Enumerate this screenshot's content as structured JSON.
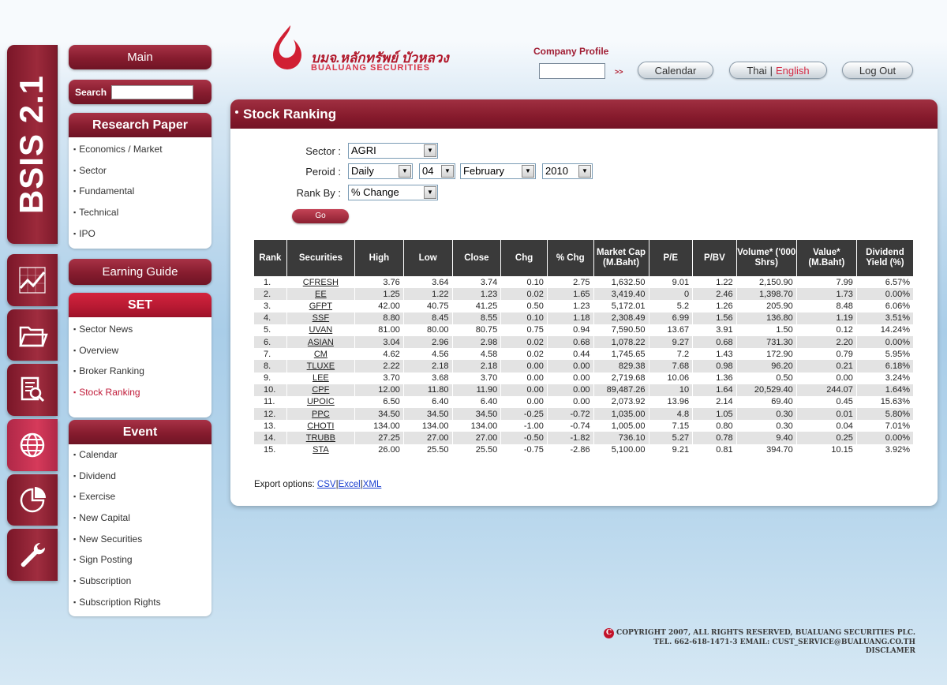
{
  "brand": {
    "thai_name": "บมจ.หลักทรัพย์ บัวหลวง",
    "english_name": "BUALUANG SECURITIES",
    "bsis_label": "BSIS 2.1"
  },
  "topbar": {
    "company_profile_label": "Company Profile",
    "company_profile_value": "",
    "go_arrow": ">>",
    "calendar_label": "Calendar",
    "lang_thai": "Thai",
    "lang_sep": "|",
    "lang_english": "English",
    "logout_label": "Log Out"
  },
  "sidebar": {
    "main_label": "Main",
    "search_label": "Search",
    "search_value": "",
    "research_title": "Research Paper",
    "research_items": [
      "Economics / Market",
      "Sector",
      "Fundamental",
      "Technical",
      "IPO"
    ],
    "earning_guide_label": "Earning Guide",
    "set_title": "SET",
    "set_items": [
      "Sector News",
      "Overview",
      "Broker Ranking",
      "Stock Ranking"
    ],
    "event_title": "Event",
    "event_items": [
      "Calendar",
      "Dividend",
      "Exercise",
      "New Capital",
      "New Securities",
      "Sign Posting",
      "Subscription",
      "Subscription Rights"
    ]
  },
  "icons": [
    "chart-icon",
    "folder-icon",
    "document-search-icon",
    "globe-icon",
    "pie-chart-icon",
    "wrench-icon"
  ],
  "page": {
    "title": "Stock Ranking"
  },
  "form": {
    "sector_label": "Sector :",
    "sector_value": "AGRI",
    "period_label": "Peroid :",
    "period_value": "Daily",
    "day_value": "04",
    "month_value": "February",
    "year_value": "2010",
    "rankby_label": "Rank By :",
    "rankby_value": "% Change",
    "go_label": "Go"
  },
  "table": {
    "headers": [
      "Rank",
      "Securities",
      "High",
      "Low",
      "Close",
      "Chg",
      "% Chg",
      "Market Cap (M.Baht)",
      "P/E",
      "P/BV",
      "Volume* ('000 Shrs)",
      "Value* (M.Baht)",
      "Dividend Yield (%)"
    ],
    "rows": [
      [
        "1.",
        "CFRESH",
        "3.76",
        "3.64",
        "3.74",
        "0.10",
        "2.75",
        "1,632.50",
        "9.01",
        "1.22",
        "2,150.90",
        "7.99",
        "6.57%"
      ],
      [
        "2.",
        "EE",
        "1.25",
        "1.22",
        "1.23",
        "0.02",
        "1.65",
        "3,419.40",
        "0",
        "2.46",
        "1,398.70",
        "1.73",
        "0.00%"
      ],
      [
        "3.",
        "GFPT",
        "42.00",
        "40.75",
        "41.25",
        "0.50",
        "1.23",
        "5,172.01",
        "5.2",
        "1.26",
        "205.90",
        "8.48",
        "6.06%"
      ],
      [
        "4.",
        "SSF",
        "8.80",
        "8.45",
        "8.55",
        "0.10",
        "1.18",
        "2,308.49",
        "6.99",
        "1.56",
        "136.80",
        "1.19",
        "3.51%"
      ],
      [
        "5.",
        "UVAN",
        "81.00",
        "80.00",
        "80.75",
        "0.75",
        "0.94",
        "7,590.50",
        "13.67",
        "3.91",
        "1.50",
        "0.12",
        "14.24%"
      ],
      [
        "6.",
        "ASIAN",
        "3.04",
        "2.96",
        "2.98",
        "0.02",
        "0.68",
        "1,078.22",
        "9.27",
        "0.68",
        "731.30",
        "2.20",
        "0.00%"
      ],
      [
        "7.",
        "CM",
        "4.62",
        "4.56",
        "4.58",
        "0.02",
        "0.44",
        "1,745.65",
        "7.2",
        "1.43",
        "172.90",
        "0.79",
        "5.95%"
      ],
      [
        "8.",
        "TLUXE",
        "2.22",
        "2.18",
        "2.18",
        "0.00",
        "0.00",
        "829.38",
        "7.68",
        "0.98",
        "96.20",
        "0.21",
        "6.18%"
      ],
      [
        "9.",
        "LEE",
        "3.70",
        "3.68",
        "3.70",
        "0.00",
        "0.00",
        "2,719.68",
        "10.06",
        "1.36",
        "0.50",
        "0.00",
        "3.24%"
      ],
      [
        "10.",
        "CPF",
        "12.00",
        "11.80",
        "11.90",
        "0.00",
        "0.00",
        "89,487.26",
        "10",
        "1.64",
        "20,529.40",
        "244.07",
        "1.64%"
      ],
      [
        "11.",
        "UPOIC",
        "6.50",
        "6.40",
        "6.40",
        "0.00",
        "0.00",
        "2,073.92",
        "13.96",
        "2.14",
        "69.40",
        "0.45",
        "15.63%"
      ],
      [
        "12.",
        "PPC",
        "34.50",
        "34.50",
        "34.50",
        "-0.25",
        "-0.72",
        "1,035.00",
        "4.8",
        "1.05",
        "0.30",
        "0.01",
        "5.80%"
      ],
      [
        "13.",
        "CHOTI",
        "134.00",
        "134.00",
        "134.00",
        "-1.00",
        "-0.74",
        "1,005.00",
        "7.15",
        "0.80",
        "0.30",
        "0.04",
        "7.01%"
      ],
      [
        "14.",
        "TRUBB",
        "27.25",
        "27.00",
        "27.00",
        "-0.50",
        "-1.82",
        "736.10",
        "5.27",
        "0.78",
        "9.40",
        "0.25",
        "0.00%"
      ],
      [
        "15.",
        "STA",
        "26.00",
        "25.50",
        "25.50",
        "-0.75",
        "-2.86",
        "5,100.00",
        "9.21",
        "0.81",
        "394.70",
        "10.15",
        "3.92%"
      ]
    ]
  },
  "export": {
    "label": "Export options:",
    "csv": "CSV",
    "excel": "Excel",
    "xml": "XML",
    "sep": "|"
  },
  "footer": {
    "copyright": "COPYRIGHT 2007, ALL RIGHTS RESERVED, BUALUANG SECURITIES PLC.",
    "contact": "TEL. 662-618-1471-3 EMAIL: CUST_SERVICE@BUALUANG.CO.TH",
    "disclaimer": "DISCLAMER"
  },
  "colors": {
    "brand_red": "#861a2c",
    "accent_red": "#c01a38",
    "header_dark": "#3a3a3a",
    "link_blue": "#1a3fd0"
  }
}
